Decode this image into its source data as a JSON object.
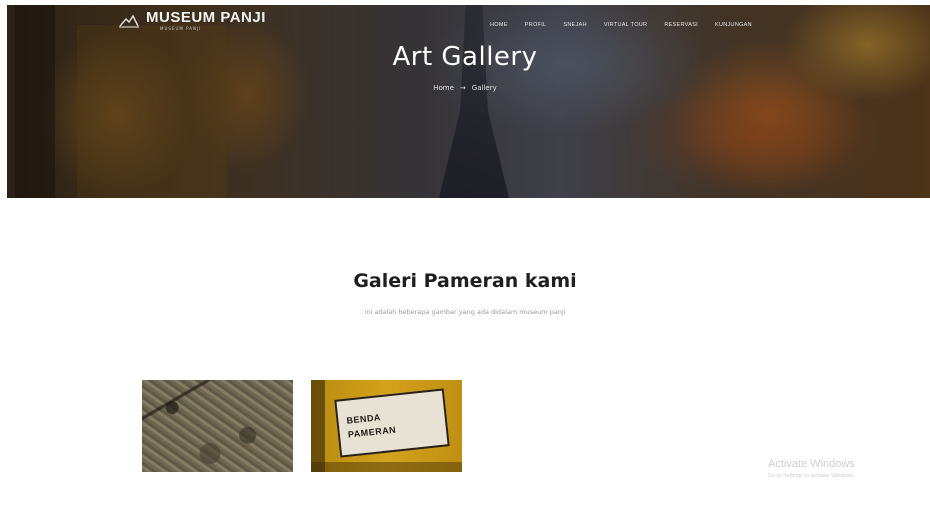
{
  "header": {
    "logo_title": "MUSEUM PANJI",
    "logo_tagline": "MUSEUM PANJI",
    "nav": [
      "HOME",
      "PROFIL",
      "SNEJAH",
      "VIRTUAL TOUR",
      "RESERVASI",
      "KUNJUNGAN"
    ]
  },
  "hero": {
    "title": "Art Gallery",
    "breadcrumb_home": "Home",
    "breadcrumb_sep": "→",
    "breadcrumb_current": "Gallery"
  },
  "section": {
    "title": "Galeri Pameran kami",
    "subtitle": "ini adalah beberapa gambar yang ada didalam museum panji"
  },
  "gallery": {
    "sign_line1": "BENDA",
    "sign_line2": "PAMERAN"
  },
  "watermark": {
    "title": "Activate Windows",
    "subtitle": "Go to Settings to activate Windows."
  },
  "colors": {
    "heading": "#1f1f1f",
    "subtitle": "#9a9a9a",
    "hero_text": "#ffffff"
  }
}
